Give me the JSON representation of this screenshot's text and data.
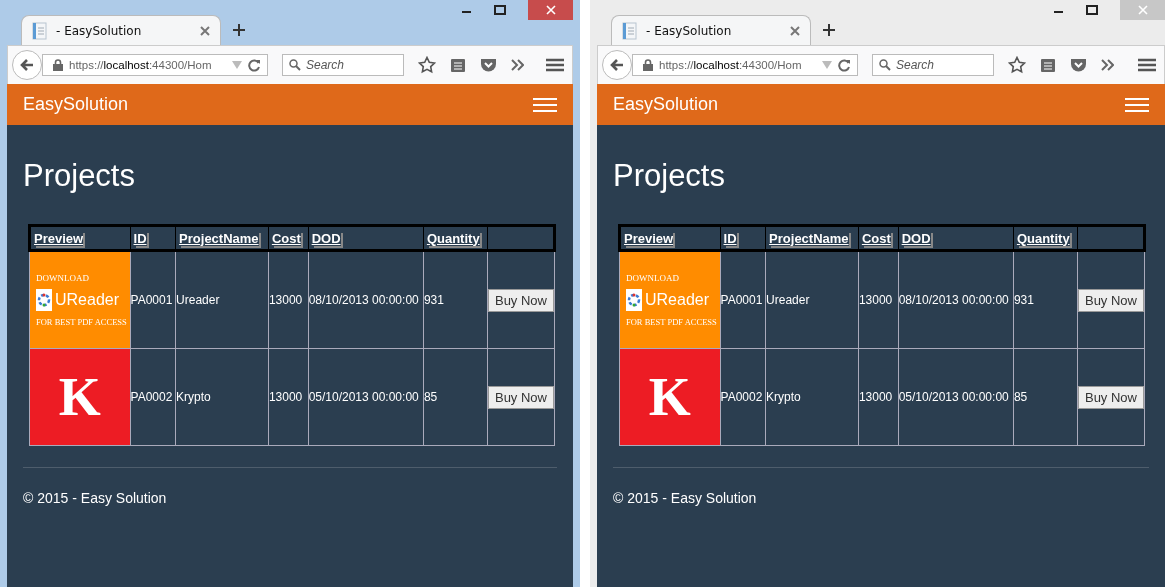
{
  "windows": [
    {
      "active": true,
      "tab": {
        "title": "- EasySolution"
      },
      "address": {
        "url": "https://**localhost**:44300/Hom"
      },
      "search": {
        "placeholder": "Search"
      },
      "navbar": {
        "brand": "EasySolution"
      },
      "heading": "Projects",
      "table": {
        "columns": [
          "Preview",
          "ID",
          "ProjectName",
          "Cost",
          "DOD",
          "Quantity"
        ],
        "rows": [
          {
            "preview": {
              "kind": "banner",
              "top": "DOWNLOAD",
              "name": "UReader",
              "bottom": "FOR BEST PDF ACCESS"
            },
            "id": "PA0001",
            "name": "Ureader",
            "cost": "13000",
            "dod": "08/10/2013 00:00:00",
            "quantity": "931",
            "button": "Buy Now"
          },
          {
            "preview": {
              "kind": "letter",
              "letter": "K"
            },
            "id": "PA0002",
            "name": "Krypto",
            "cost": "13000",
            "dod": "05/10/2013 00:00:00",
            "quantity": "85",
            "button": "Buy Now"
          }
        ]
      },
      "footer": "© 2015 - Easy Solution"
    },
    {
      "active": false,
      "tab": {
        "title": "- EasySolution"
      },
      "address": {
        "url": "https://**localhost**:44300/Hom"
      },
      "search": {
        "placeholder": "Search"
      },
      "navbar": {
        "brand": "EasySolution"
      },
      "heading": "Projects",
      "table": {
        "columns": [
          "Preview",
          "ID",
          "ProjectName",
          "Cost",
          "DOD",
          "Quantity"
        ],
        "rows": [
          {
            "preview": {
              "kind": "banner",
              "top": "DOWNLOAD",
              "name": "UReader",
              "bottom": "FOR BEST PDF ACCESS"
            },
            "id": "PA0001",
            "name": "Ureader",
            "cost": "13000",
            "dod": "08/10/2013 00:00:00",
            "quantity": "931",
            "button": "Buy Now"
          },
          {
            "preview": {
              "kind": "letter",
              "letter": "K"
            },
            "id": "PA0002",
            "name": "Krypto",
            "cost": "13000",
            "dod": "05/10/2013 00:00:00",
            "quantity": "85",
            "button": "Buy Now"
          }
        ]
      },
      "footer": "© 2015 - Easy Solution"
    }
  ]
}
